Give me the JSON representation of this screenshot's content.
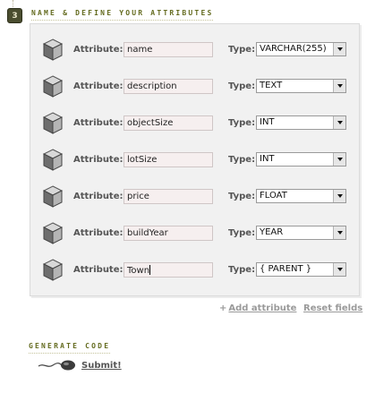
{
  "step": {
    "number": "3",
    "title": "NAME & DEFINE YOUR ATTRIBUTES"
  },
  "attribute_label": "Attribute:",
  "type_label": "Type:",
  "attributes": [
    {
      "name": "name",
      "type": "VARCHAR(255)"
    },
    {
      "name": "description",
      "type": "TEXT"
    },
    {
      "name": "objectSize",
      "type": "INT"
    },
    {
      "name": "lotSize",
      "type": "INT"
    },
    {
      "name": "price",
      "type": "FLOAT"
    },
    {
      "name": "buildYear",
      "type": "YEAR"
    },
    {
      "name": "Town",
      "type": "{ PARENT }"
    }
  ],
  "actions": {
    "add_plus": "+",
    "add_label": "Add attribute",
    "reset_label": "Reset fields"
  },
  "generate": {
    "title": "GENERATE CODE",
    "submit_label": "Submit!"
  },
  "icons": {
    "row_icon": "cube-icon",
    "submit_icon": "sperm-icon"
  },
  "colors": {
    "accent_title": "#646b1f",
    "badge": "#4a4d2f",
    "input_bg": "#f6efef",
    "panel_bg": "#f1f1f1"
  }
}
